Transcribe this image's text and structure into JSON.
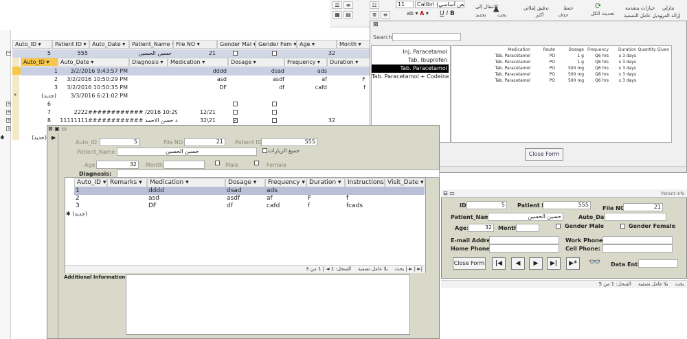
{
  "ribbon": {
    "font_size": "11",
    "font_name": "Calibri (نص أساسي)",
    "item_1": "خيارات متقدمة",
    "item_2": "تبديل عامل التصفية",
    "item_3": "الانتقال إلى",
    "item_4": "تحديد",
    "item_5": "تدقيق إملائي",
    "item_6": "بحث",
    "item_7": "حفظ",
    "item_8": "حذف",
    "item_9": "أكثر",
    "item_10": "تحديث الكل",
    "item_11": "تنازلي",
    "item_12": "إزالة الفرز"
  },
  "datasheet": {
    "columns": [
      "Auto_ID",
      "Patient ID",
      "Auto_Date",
      "Patient_Name",
      "File NO",
      "Gender Mal",
      "Gender Fem",
      "Age",
      "Month"
    ],
    "rows": [
      {
        "auto_id": "5",
        "patient_id": "555",
        "name": "حسين الحسين",
        "file_no": "21",
        "age": "32"
      },
      {
        "auto_id": "6",
        "patient_id": "",
        "name": "",
        "file_no": "",
        "age": ""
      },
      {
        "auto_id": "7",
        "patient_id": "2222",
        "date": "############ /2016 10:29:23 PM",
        "file_no": "12/21",
        "age": ""
      },
      {
        "auto_id": "8",
        "patient_id": "11111111",
        "date": "############ خالد حسن الاحمد",
        "file_no": "32\\21",
        "age": "32"
      }
    ],
    "new_label": "(جديد)",
    "sub_columns": [
      "Auto_ID",
      "Auto_Date",
      "Diagnosis",
      "Medication",
      "Dosage",
      "Frequency",
      "Duration"
    ],
    "sub_rows": [
      {
        "id": "1",
        "date": "3/2/2016 9:43:57 PM",
        "medication": "dddd",
        "dosage": "dsad",
        "frequency": "ads",
        "duration": ""
      },
      {
        "id": "2",
        "date": "3/2/2016 10:50:29 PM",
        "medication": "asd",
        "dosage": "asdf",
        "frequency": "af",
        "duration": "F"
      },
      {
        "id": "3",
        "date": "3/2/2016 10:50:35 PM",
        "medication": "DF",
        "dosage": "df",
        "frequency": "cafd",
        "duration": "f"
      }
    ],
    "sub_new_date": "3/3/2016 6:21:02 PM",
    "new_marker": "*"
  },
  "search_form": {
    "search_label": "Search",
    "list_items": [
      "Inj. Paracetamol",
      "Tab. Ibuprofen",
      "Tab. Paracetamol",
      "Tab. Paracetamol + Codeine"
    ],
    "selected_index": 2,
    "grid_columns": [
      "Medication",
      "Route",
      "Dosage",
      "Frequency",
      "Duration",
      "Quantity Given"
    ],
    "grid_rows": [
      [
        "Tab. Paracetamol",
        "PO",
        "1 g",
        "Q6 hrs",
        "x 3 days",
        ""
      ],
      [
        "Tab. Paracetamol",
        "PO",
        "1 g",
        "Q6 hrs",
        "x 3 days",
        ""
      ],
      [
        "Tab. Paracetamol",
        "PO",
        "500 mg",
        "Q6 hrs",
        "x 3 days",
        ""
      ],
      [
        "Tab. Paracetamol",
        "PO",
        "500 mg",
        "Q8 hrs",
        "x 3 days",
        ""
      ],
      [
        "Tab. Paracetamol",
        "PO",
        "500 mg",
        "Q6 hrs",
        "x 3 days",
        ""
      ]
    ],
    "close_label": "Close Form"
  },
  "visit_form": {
    "auto_id_label": "Auto_ID",
    "auto_id": "5",
    "file_no_label": "File NO",
    "file_no": "21",
    "patient_id_label": "Patient ID",
    "patient_id": "555",
    "patient_name_label": "Patient_Name",
    "patient_name": "حسين الحسين",
    "visits_label": "جميع الزيارات",
    "age_label": "Age",
    "age": "32",
    "month_label": "Month",
    "male_label": "Male",
    "female_label": "Female",
    "diagnosis_label": "Diagnosis:",
    "grid_columns": [
      "Auto_ID",
      "Remarks",
      "Medication",
      "Dosage",
      "Frequency",
      "Duration",
      "Instructions",
      "Visit_Date"
    ],
    "grid_rows": [
      {
        "id": "1",
        "remarks": "",
        "medication": "dddd",
        "dosage": "dsad",
        "frequency": "ads",
        "duration": "",
        "instructions": ""
      },
      {
        "id": "2",
        "remarks": "",
        "medication": "asd",
        "dosage": "asdf",
        "frequency": "af",
        "duration": "F",
        "instructions": "f"
      },
      {
        "id": "3",
        "remarks": "",
        "medication": "DF",
        "dosage": "df",
        "frequency": "cafd",
        "duration": "f",
        "instructions": "fcads"
      }
    ],
    "new_row": "(جديد)",
    "nav_record": "السجل: 1 ◄ | 1 من 3 | ► | ►|",
    "nav_filter": "بلا عامل تصفية",
    "nav_search": "بحث",
    "additional_label": "Additional Information:"
  },
  "patient_form": {
    "title": "Patient Info",
    "id_label": "ID",
    "id": "5",
    "patient_id_label": "Patient ID:",
    "patient_id": "555",
    "file_no_label": "File NO:",
    "file_no": "21",
    "name_label": "Patient_Name:",
    "name": "حسين الحسين",
    "auto_date_label": "Auto_Date:",
    "age_label": "Age:",
    "age": "32",
    "month_label": "Month:",
    "male_label": "Gender Male",
    "female_label": "Gender Female",
    "email_label": "E-mail Address:",
    "work_label": "Work Phone:",
    "home_label": "Home Phone:",
    "cell_label": "Cell Phone:",
    "close_label": "Close Form",
    "data_entry_label": "Data Entry:",
    "nav_record": "السجل: 1 من 5",
    "nav_filter": "بلا عامل تصفية",
    "nav_search": "بحث"
  }
}
